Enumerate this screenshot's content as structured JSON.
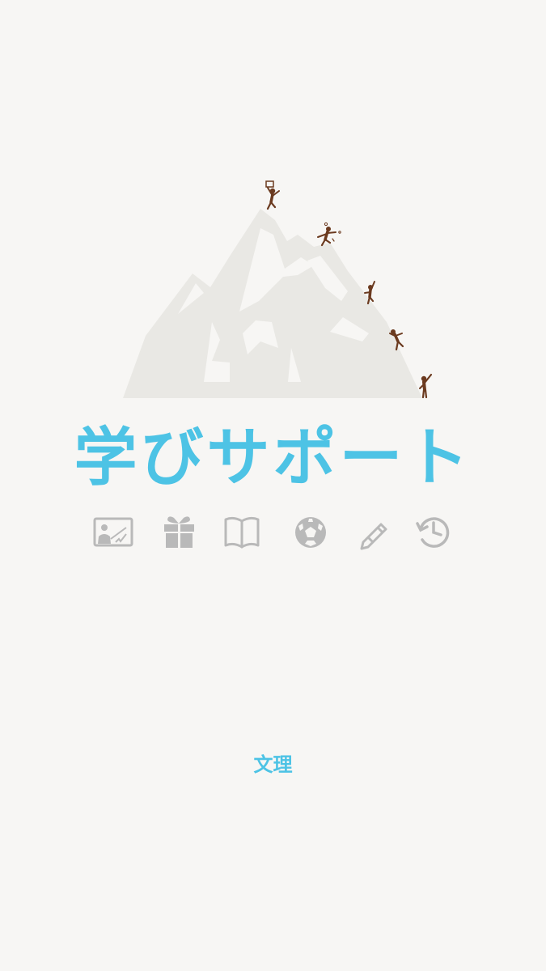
{
  "app": {
    "title": "学びサポート",
    "footer_label": "文理"
  },
  "colors": {
    "background": "#f7f6f4",
    "accent": "#4dc3e5",
    "mountain": "#e9e8e4",
    "climber": "#6b3a1f",
    "icon": "#b9b9b9"
  },
  "feature_icons": [
    "lecture-board-icon",
    "gift-icon",
    "open-book-icon",
    "soccer-ball-icon",
    "pencil-icon",
    "history-icon"
  ]
}
